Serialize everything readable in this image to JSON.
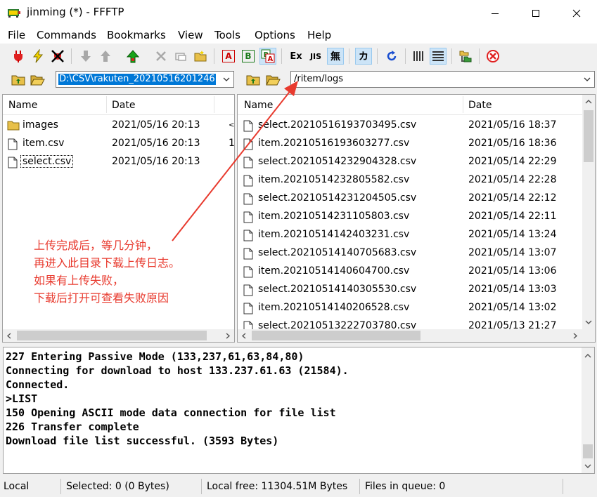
{
  "window": {
    "title": "jinming (*) - FFFTP",
    "app_icon": "ffftp-app-icon",
    "controls": [
      "minimize-icon",
      "maximize-icon",
      "close-icon"
    ]
  },
  "menu": [
    "File",
    "Commands",
    "Bookmarks",
    "View",
    "Tools",
    "Options",
    "Help"
  ],
  "toolbar": {
    "letters": {
      "ascii": "A",
      "binary": "B",
      "exec": "Ex",
      "jis": "JIS",
      "nokanji": "無",
      "kana": "カ"
    },
    "icons": [
      "connect-icon",
      "quick-connect-icon",
      "disconnect-icon",
      "download-icon",
      "upload-icon",
      "mirror-upload-icon",
      "delete-icon",
      "rename-icon",
      "mkdir-icon",
      "ascii-mode-icon",
      "binary-mode-icon",
      "auto-mode-icon",
      "euc-icon",
      "jis-icon",
      "no-conversion-icon",
      "kana-icon",
      "refresh-icon",
      "list-view-icon",
      "detail-view-icon",
      "sync-dirs-icon",
      "stop-icon"
    ]
  },
  "local": {
    "path": "D:\\CSV\\rakuten_20210516201246",
    "columns": [
      "Name",
      "Date"
    ],
    "files": [
      {
        "name": "images",
        "date": "2021/05/16 20:13",
        "extra": "<",
        "type": "folder"
      },
      {
        "name": "item.csv",
        "date": "2021/05/16 20:13",
        "extra": "1",
        "type": "file"
      },
      {
        "name": "select.csv",
        "date": "2021/05/16 20:13",
        "extra": "",
        "type": "file"
      }
    ]
  },
  "remote": {
    "path": "/ritem/logs",
    "columns": [
      "Name",
      "Date"
    ],
    "files": [
      {
        "name": "select.20210516193703495.csv",
        "date": "2021/05/16 18:37"
      },
      {
        "name": "item.20210516193603277.csv",
        "date": "2021/05/16 18:36"
      },
      {
        "name": "select.20210514232904328.csv",
        "date": "2021/05/14 22:29"
      },
      {
        "name": "item.20210514232805582.csv",
        "date": "2021/05/14 22:28"
      },
      {
        "name": "select.20210514231204505.csv",
        "date": "2021/05/14 22:12"
      },
      {
        "name": "item.20210514231105803.csv",
        "date": "2021/05/14 22:11"
      },
      {
        "name": "item.20210514142403231.csv",
        "date": "2021/05/14 13:24"
      },
      {
        "name": "select.20210514140705683.csv",
        "date": "2021/05/14 13:07"
      },
      {
        "name": "item.20210514140604700.csv",
        "date": "2021/05/14 13:06"
      },
      {
        "name": "select.20210514140305530.csv",
        "date": "2021/05/14 13:03"
      },
      {
        "name": "item.20210514140206528.csv",
        "date": "2021/05/14 13:02"
      },
      {
        "name": "select.20210513222703780.csv",
        "date": "2021/05/13 21:27"
      }
    ]
  },
  "log": [
    "227 Entering Passive Mode (133,237,61,63,84,80)",
    "Connecting for download to host 133.237.61.63 (21584).",
    "Connected.",
    ">LIST",
    "150 Opening ASCII mode data connection for file list",
    "226 Transfer complete",
    "Download file list successful. (3593 Bytes)"
  ],
  "status": {
    "mode": "Local",
    "selected": "Selected: 0 (0 Bytes)",
    "free": "Local free: 11304.51M Bytes",
    "queue": "Files in queue: 0"
  },
  "annotation": {
    "lines": [
      "上传完成后，等几分钟，",
      "再进入此目录下载上传日志。",
      "如果有上传失败，",
      "下载后打开可查看失败原因"
    ],
    "color": "#e83a2e"
  },
  "colors": {
    "selection": "#0078d7",
    "folder": "#e8c049"
  }
}
